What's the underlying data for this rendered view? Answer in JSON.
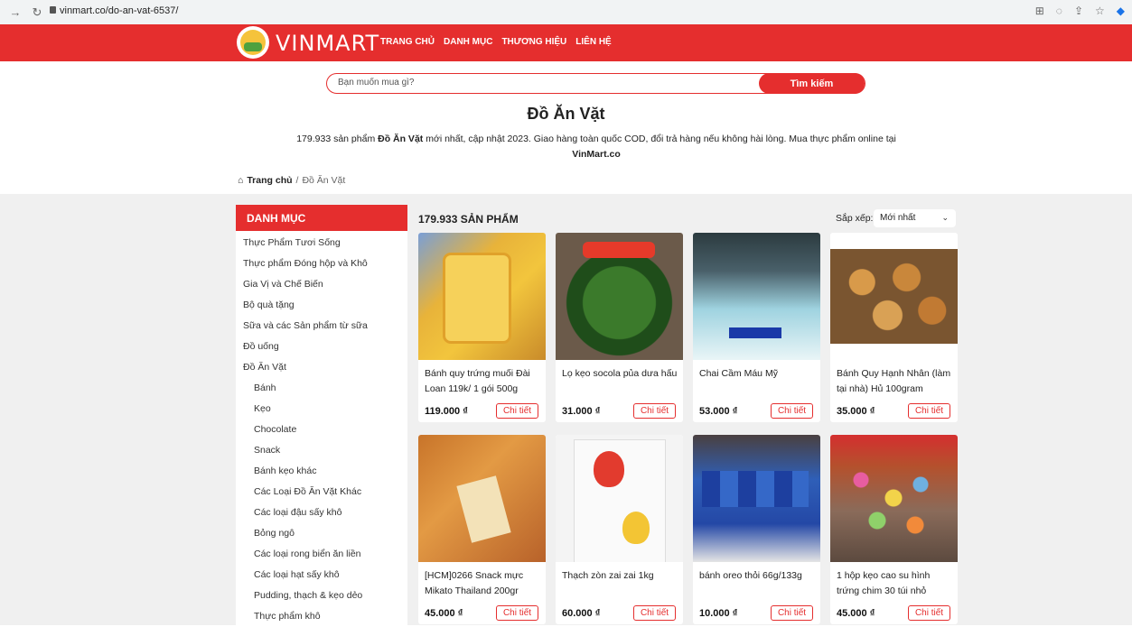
{
  "browser": {
    "url": "vinmart.co/do-an-vat-6537/"
  },
  "header": {
    "logo_text": "VINMART",
    "nav": [
      "TRANG CHỦ",
      "DANH MỤC",
      "THƯƠNG HIỆU",
      "LIÊN HỆ"
    ],
    "brand_color": "#e52e2e"
  },
  "search": {
    "placeholder": "Bạn muốn mua gì?",
    "button_label": "Tìm kiếm"
  },
  "page": {
    "title": "Đồ Ăn Vặt",
    "desc_prefix": "179.933 sản phẩm ",
    "desc_bold": "Đồ Ăn Vặt",
    "desc_mid": " mới nhất, cập nhật 2023. Giao hàng toàn quốc COD, đổi trả hàng nếu không hài lòng. Mua thực phẩm online tại ",
    "desc_site": "VinMart.co"
  },
  "breadcrumb": {
    "home": "Trang chủ",
    "separator": "/",
    "current": "Đồ Ăn Vặt"
  },
  "sidebar": {
    "title": "DANH MỤC",
    "items": [
      {
        "label": "Thực Phẩm Tươi Sống",
        "sub": false
      },
      {
        "label": "Thực phẩm Đóng hộp và Khô",
        "sub": false
      },
      {
        "label": "Gia Vị và Chế Biến",
        "sub": false
      },
      {
        "label": "Bộ quà tặng",
        "sub": false
      },
      {
        "label": "Sữa và các Sản phẩm từ sữa",
        "sub": false
      },
      {
        "label": "Đồ uống",
        "sub": false
      },
      {
        "label": "Đồ Ăn Vặt",
        "sub": false
      },
      {
        "label": "Bánh",
        "sub": true
      },
      {
        "label": "Kẹo",
        "sub": true
      },
      {
        "label": "Chocolate",
        "sub": true
      },
      {
        "label": "Snack",
        "sub": true
      },
      {
        "label": "Bánh kẹo khác",
        "sub": true
      },
      {
        "label": "Các Loại Đồ Ăn Vặt Khác",
        "sub": true
      },
      {
        "label": "Các loại đậu sấy khô",
        "sub": true
      },
      {
        "label": "Bỏng ngô",
        "sub": true
      },
      {
        "label": "Các loại rong biển ăn liền",
        "sub": true
      },
      {
        "label": "Các loại hạt sấy khô",
        "sub": true
      },
      {
        "label": "Pudding, thạch & kẹo dẻo",
        "sub": true
      },
      {
        "label": "Thực phẩm khô",
        "sub": true
      }
    ]
  },
  "listing": {
    "count_label": "179.933 SẢN PHẨM",
    "sort_label": "Sắp xếp:",
    "sort_value": "Mới nhất"
  },
  "products": [
    {
      "name": "Bánh quy trứng muối Đài Loan 119k/ 1 gói 500g",
      "price": "119.000 ₫",
      "detail": "Chi tiết"
    },
    {
      "name": "Lọ kẹo socola pủa dưa hấu",
      "price": "31.000 ₫",
      "detail": "Chi tiết"
    },
    {
      "name": "Chai Cầm Máu Mỹ",
      "price": "53.000 ₫",
      "detail": "Chi tiết"
    },
    {
      "name": "Bánh Quy Hạnh Nhân (làm tại nhà) Hủ 100gram",
      "price": "35.000 ₫",
      "detail": "Chi tiết"
    },
    {
      "name": "[HCM]0266 Snack mực Mikato Thailand 200gr",
      "price": "45.000 ₫",
      "detail": "Chi tiết"
    },
    {
      "name": "Thạch zòn zai zai 1kg",
      "price": "60.000 ₫",
      "detail": "Chi tiết"
    },
    {
      "name": "bánh oreo thỏi 66g/133g",
      "price": "10.000 ₫",
      "detail": "Chi tiết"
    },
    {
      "name": "1 hộp kẹo cao su hình trứng chim 30 túi nhỏ",
      "price": "45.000 ₫",
      "detail": "Chi tiết"
    }
  ]
}
